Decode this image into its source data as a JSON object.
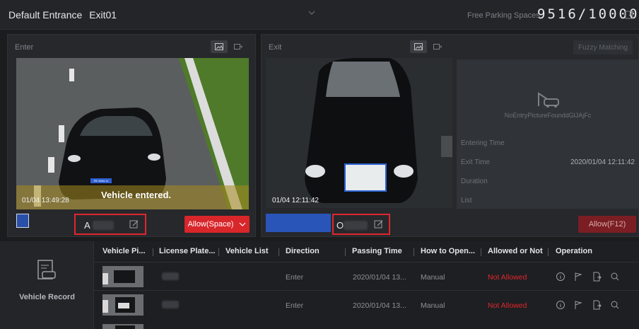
{
  "header": {
    "entrance": "Default Entrance",
    "exit_name": "Exit01",
    "free_spaces_label": "Free Parking Spaces",
    "free_spaces_value": "9516/10000"
  },
  "enter_panel": {
    "label": "Enter",
    "timestamp": "01/04 13:49:28",
    "overlay_text": "Vehicle entered.",
    "plate_prefix": "A",
    "plate_on_car": "RE 6654.11",
    "allow_button": "Allow(Space)"
  },
  "exit_panel": {
    "label": "Exit",
    "timestamp": "01/04 12:11:42",
    "plate_prefix": "O",
    "fuzzy_button": "Fuzzy Matching",
    "no_picture": "NoEntryPictureFounddGlJAjFc",
    "entering_time_label": "Entering Time",
    "exit_time_label": "Exit Time",
    "exit_time_value": "2020/01/04 12:11:42",
    "duration_label": "Duration",
    "list_label": "List",
    "allow_button": "Allow(F12)"
  },
  "records": {
    "section_label": "Vehicle Record",
    "columns": [
      "Vehicle Pi...",
      "License Plate...",
      "Vehicle List",
      "Direction",
      "Passing Time",
      "How to Open...",
      "Allowed or Not",
      "Operation"
    ],
    "rows": [
      {
        "direction": "Enter",
        "passing_time": "2020/01/04 13...",
        "how_to_open": "Manual",
        "allowed": "Not Allowed"
      },
      {
        "direction": "Enter",
        "passing_time": "2020/01/04 13...",
        "how_to_open": "Manual",
        "allowed": "Not Allowed"
      }
    ]
  },
  "colors": {
    "accent_red": "#d8262b",
    "not_allowed": "#e0262c"
  }
}
